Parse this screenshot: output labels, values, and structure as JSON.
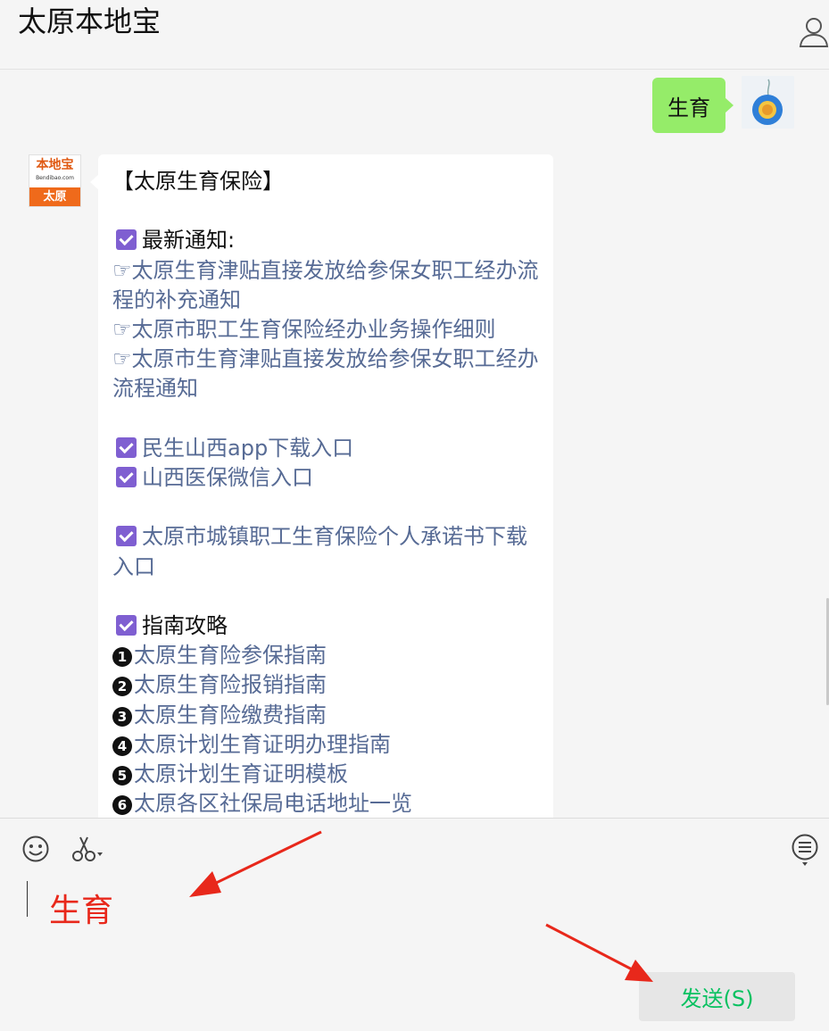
{
  "header": {
    "title": "太原本地宝"
  },
  "sent_message": {
    "text": "生育"
  },
  "bot": {
    "avatar": {
      "logo_text": "本地宝",
      "logo_sub": "Bendibao.com",
      "city": "太原"
    }
  },
  "reply": {
    "title": "【太原生育保险】",
    "section1_label": "最新通知:",
    "notices": [
      "太原生育津贴直接发放给参保女职工经办流程的补充通知",
      "太原市职工生育保险经办业务操作细则",
      "太原市生育津贴直接发放给参保女职工经办流程通知"
    ],
    "links_a": [
      "民生山西app下载入口",
      "山西医保微信入口"
    ],
    "link_b": "太原市城镇职工生育保险个人承诺书下载入口",
    "section2_label": "指南攻略",
    "guides": [
      {
        "num": "1",
        "text": "太原生育险参保指南"
      },
      {
        "num": "2",
        "text": "太原生育险报销指南"
      },
      {
        "num": "3",
        "text": "太原生育险缴费指南"
      },
      {
        "num": "4",
        "text": "太原计划生育证明办理指南"
      },
      {
        "num": "5",
        "text": "太原计划生育证明模板"
      },
      {
        "num": "6",
        "text": "太原各区社保局电话地址一览"
      }
    ]
  },
  "input": {
    "value": "生育",
    "send_label": "发送(S)"
  },
  "colors": {
    "sent_bubble": "#95ec69",
    "link": "#576b95",
    "send_text": "#07c160",
    "typed_text": "#e8281b",
    "arrow": "#e8281b"
  },
  "icons": [
    "user-icon",
    "emoji-icon",
    "scissors-icon",
    "chat-history-icon"
  ]
}
